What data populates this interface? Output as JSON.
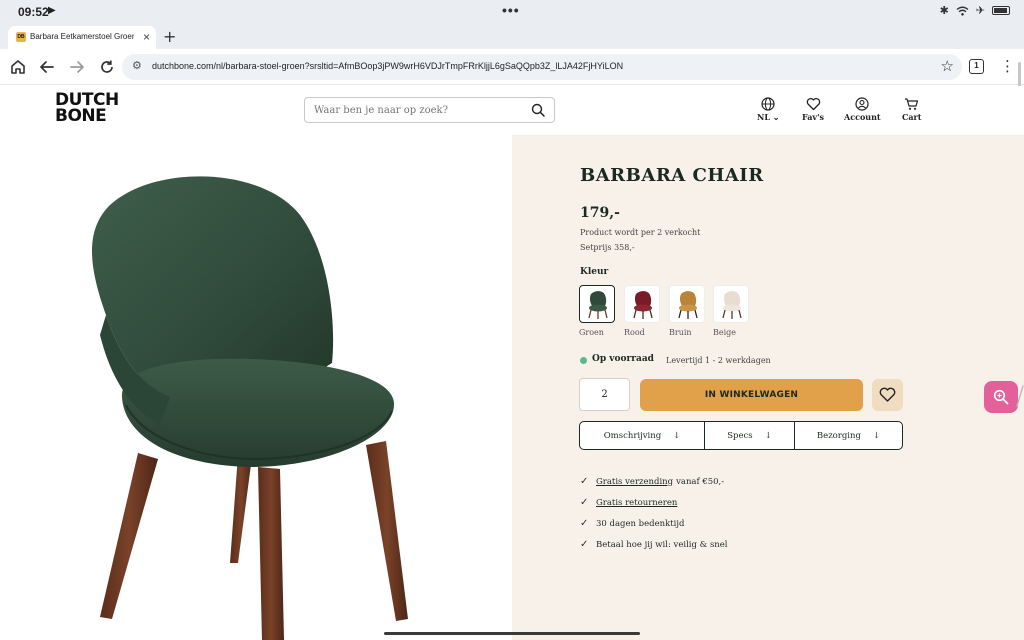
{
  "status_bar": {
    "time": "09:52",
    "media_icon": "play-icon",
    "dots": "•••",
    "icons": [
      "bluetooth-icon",
      "wifi-icon",
      "airplane-icon",
      "battery-icon"
    ]
  },
  "browser": {
    "tab": {
      "favicon_text": "DB",
      "title": "Barbara Eetkamerstoel Groen | D",
      "close": "×"
    },
    "new_tab": "+",
    "url": "dutchbone.com/nl/barbara-stoel-groen?srsltid=AfmBOop3jPW9wrH6VDJrTmpFRrKljjL6gSaQQpb3Z_lLJA42FjHYiLON",
    "tab_count": "1"
  },
  "site": {
    "logo_line1": "DUTCH",
    "logo_line2": "BONE",
    "search_placeholder": "Waar ben je naar op zoek?",
    "nav": {
      "language": "NL",
      "favs": "Fav's",
      "account": "Account",
      "cart": "Cart"
    }
  },
  "product": {
    "title": "BARBARA CHAIR",
    "price": "179,-",
    "sold_per": "Product wordt per 2 verkocht",
    "set_price": "Setprijs 358,-",
    "color_label": "Kleur",
    "colors": [
      {
        "name": "Groen",
        "hex": "#2f4a3a",
        "selected": true
      },
      {
        "name": "Rood",
        "hex": "#7a1c28",
        "selected": false
      },
      {
        "name": "Bruin",
        "hex": "#b9843a",
        "selected": false
      },
      {
        "name": "Beige",
        "hex": "#e8ddd0",
        "selected": false
      }
    ],
    "stock_status": "Op voorraad",
    "delivery_time": "Levertijd 1 - 2 werkdagen",
    "quantity": "2",
    "add_to_cart": "IN WINKELWAGEN",
    "info_tabs": [
      "Omschrijving",
      "Specs",
      "Bezorging"
    ],
    "usps": [
      {
        "link": "Gratis verzending",
        "text": "vanaf €50,-"
      },
      {
        "link": "Gratis retourneren",
        "text": ""
      },
      {
        "link": "",
        "text": "30 dagen bedenktijd"
      },
      {
        "link": "",
        "text": "Betaal hoe jij wil: veilig & snel"
      }
    ]
  },
  "colors": {
    "accent": "#e0a14a",
    "panel_bg": "#f8f1ea",
    "stock_green": "#5bb98a",
    "zoom_pink": "#e3609b",
    "chair_green": "#2f4a3a",
    "leg_wood": "#6b3a24"
  }
}
